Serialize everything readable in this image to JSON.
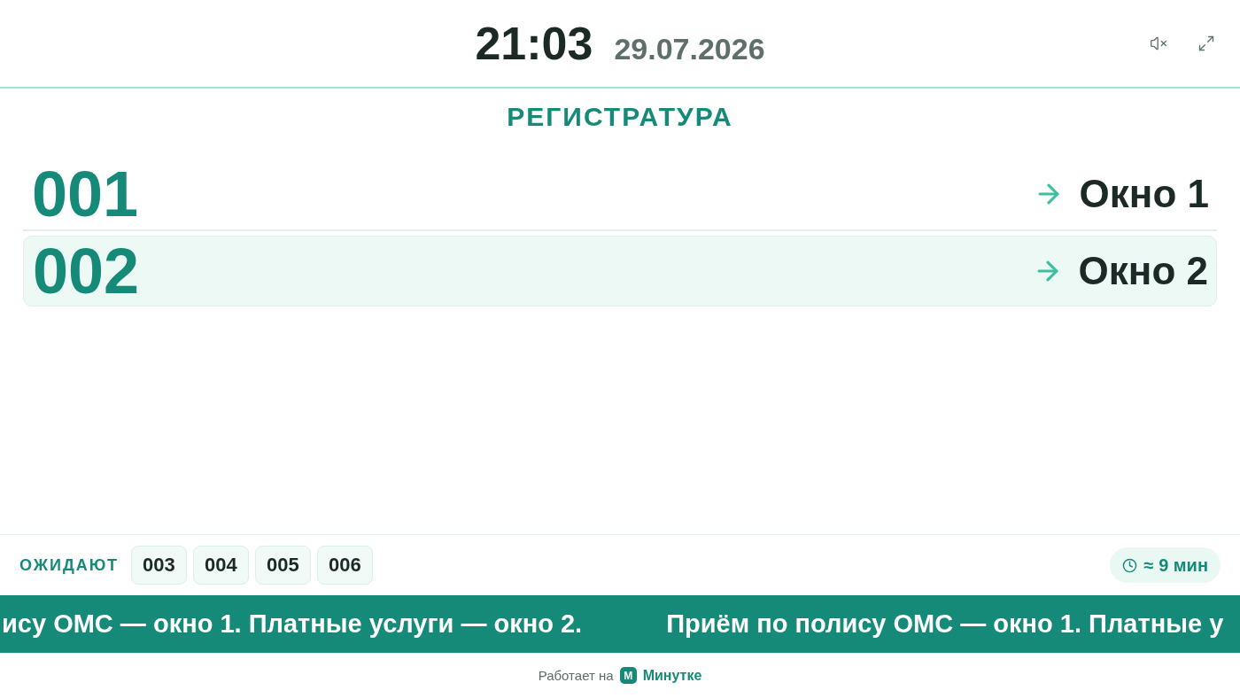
{
  "header": {
    "time": "21:03",
    "date": "29.07.2026",
    "muted": true
  },
  "department": "РЕГИСТРАТУРА",
  "called": [
    {
      "ticket": "001",
      "window": "Окно 1",
      "highlighted": false
    },
    {
      "ticket": "002",
      "window": "Окно 2",
      "highlighted": true
    }
  ],
  "waiting": {
    "label": "ОЖИДАЮТ",
    "tickets": [
      "003",
      "004",
      "005",
      "006"
    ],
    "estimate": "≈ 9 мин"
  },
  "ticker": [
    "ису ОМС — окно 1. Платные услуги — окно 2.",
    "Приём по полису ОМС — окно 1. Платные у"
  ],
  "footer": {
    "text": "Работает на",
    "logo_letter": "М",
    "brand": "Минутке"
  }
}
